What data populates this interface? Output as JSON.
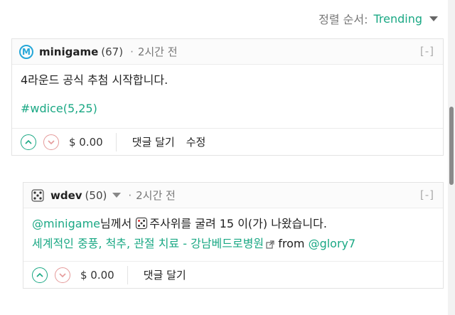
{
  "sort": {
    "label": "정렬 순서:",
    "value": "Trending"
  },
  "comments": [
    {
      "author": "minigame",
      "reputation": "(67)",
      "time": "2시간 전",
      "collapse": "[-]",
      "body": [
        "4라운드 공식 추첨 시작합니다.",
        "#wdice(5,25)"
      ],
      "payout": "$ 0.00",
      "actions": [
        "댓글 달기",
        "수정"
      ]
    },
    {
      "author": "wdev",
      "reputation": "(50)",
      "time": "2시간 전",
      "collapse": "[-]",
      "mention": "@minigame",
      "text_after_mention": "님께서 ",
      "dice_text": "주사위를 굴려 15 이(가) 나왔습니다.",
      "ad_link": "세계적인 중풍, 척추, 관절 치료 - 강남베드로병원",
      "from_text": "from",
      "from_user": "@glory7",
      "payout": "$ 0.00",
      "actions": [
        "댓글 달기"
      ]
    }
  ],
  "colors": {
    "accent": "#1aa884",
    "downvote": "#e59a9a",
    "avatar": "#25a7d8"
  },
  "icons": [
    "upvote-icon",
    "downvote-icon",
    "external-link-icon",
    "dice-icon"
  ]
}
